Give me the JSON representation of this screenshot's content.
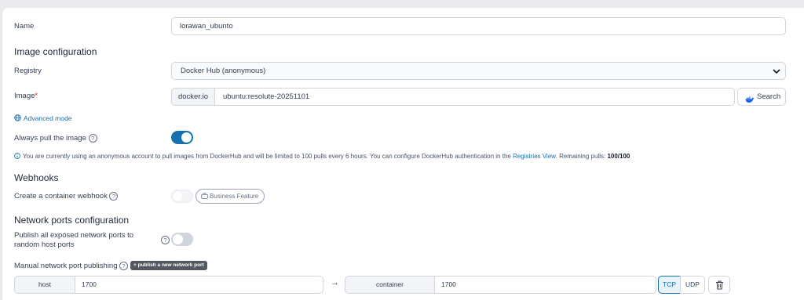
{
  "name": {
    "label": "Name",
    "value": "lorawan_ubunto"
  },
  "image_config": {
    "heading": "Image configuration",
    "registry_label": "Registry",
    "registry_value": "Docker Hub (anonymous)",
    "image_label": "Image",
    "required_mark": "*",
    "image_prefix": "docker.io",
    "image_value": "ubuntu:resolute-20251101",
    "search_label": "Search",
    "advanced_mode": "Advanced mode",
    "always_pull_label": "Always pull the image",
    "always_pull_on": true,
    "help_glyph": "?",
    "info_text": "You are currently using an anonymous account to pull images from DockerHub and will be limited to 100 pulls every 6 hours. You can configure DockerHub authentication in the",
    "info_link": "Registries View.",
    "remaining_label": "Remaining pulls:",
    "remaining_value": "100/100"
  },
  "webhooks": {
    "heading": "Webhooks",
    "label": "Create a container webhook",
    "business_label": "Business Feature"
  },
  "network": {
    "heading": "Network ports configuration",
    "publish_all_label": "Publish all exposed network ports to random host ports",
    "manual_label": "Manual network port publishing",
    "publish_new": "publish a new network port",
    "port_row": {
      "host_label": "host",
      "host_value": "1700",
      "arrow": "→",
      "container_label": "container",
      "container_value": "1700",
      "tcp": "TCP",
      "udp": "UDP"
    }
  },
  "colors": {
    "accent": "#1570ad",
    "toggle_off": "#d0d5dd"
  }
}
